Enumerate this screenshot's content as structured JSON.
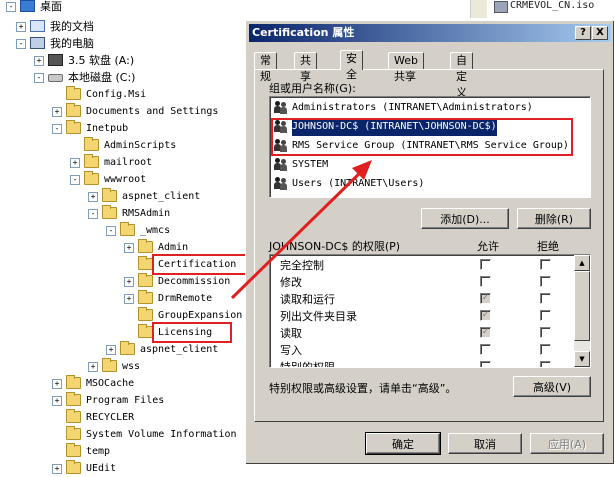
{
  "tree": [
    {
      "label": "桌面",
      "icon": "desktop-icon",
      "expander": "-"
    },
    {
      "label": "我的文档",
      "icon": "my-documents-icon",
      "expander": "+"
    },
    {
      "label": "我的电脑",
      "icon": "my-computer-icon",
      "expander": "-"
    },
    {
      "label": "3.5 软盘 (A:)",
      "icon": "floppy-drive-icon",
      "expander": "+"
    },
    {
      "label": "本地磁盘 (C:)",
      "icon": "local-disk-icon",
      "expander": "-"
    },
    {
      "label": "Config.Msi",
      "icon": "folder-icon",
      "expander": ""
    },
    {
      "label": "Documents and Settings",
      "icon": "folder-icon",
      "expander": "+"
    },
    {
      "label": "Inetpub",
      "icon": "folder-icon",
      "expander": "-"
    },
    {
      "label": "AdminScripts",
      "icon": "folder-icon",
      "expander": ""
    },
    {
      "label": "mailroot",
      "icon": "folder-icon",
      "expander": "+"
    },
    {
      "label": "wwwroot",
      "icon": "folder-icon",
      "expander": "-"
    },
    {
      "label": "aspnet_client",
      "icon": "folder-icon",
      "expander": "+"
    },
    {
      "label": "RMSAdmin",
      "icon": "folder-icon",
      "expander": "-"
    },
    {
      "label": "_wmcs",
      "icon": "folder-icon",
      "expander": "-"
    },
    {
      "label": "Admin",
      "icon": "folder-icon",
      "expander": "+"
    },
    {
      "label": "Certification",
      "icon": "folder-icon",
      "expander": ""
    },
    {
      "label": "Decommission",
      "icon": "folder-icon",
      "expander": "+"
    },
    {
      "label": "DrmRemote",
      "icon": "folder-icon",
      "expander": "+"
    },
    {
      "label": "GroupExpansion",
      "icon": "folder-icon",
      "expander": ""
    },
    {
      "label": "Licensing",
      "icon": "folder-icon",
      "expander": ""
    },
    {
      "label": "aspnet_client",
      "icon": "folder-icon",
      "expander": "+"
    },
    {
      "label": "wss",
      "icon": "folder-icon",
      "expander": "+"
    },
    {
      "label": "MSOCache",
      "icon": "folder-icon",
      "expander": "+"
    },
    {
      "label": "Program Files",
      "icon": "folder-icon",
      "expander": "+"
    },
    {
      "label": "RECYCLER",
      "icon": "folder-icon",
      "expander": ""
    },
    {
      "label": "System Volume Information",
      "icon": "folder-icon",
      "expander": ""
    },
    {
      "label": "temp",
      "icon": "folder-icon",
      "expander": ""
    },
    {
      "label": "UEdit",
      "icon": "folder-icon",
      "expander": "+"
    }
  ],
  "right_list_item": "CRMEVOL_CN.iso",
  "dialog": {
    "title": "Certification 属性",
    "help_btn": "?",
    "close_btn": "X",
    "tabs": [
      "常规",
      "共享",
      "安全",
      "Web 共享",
      "自定义"
    ],
    "group_label": "组或用户名称(G):",
    "users": [
      "Administrators (INTRANET\\Administrators)",
      "JOHNSON-DC$ (INTRANET\\JOHNSON-DC$)",
      "RMS Service Group (INTRANET\\RMS Service Group)",
      "SYSTEM",
      "Users (INTRANET\\Users)"
    ],
    "add_btn": "添加(D)...",
    "remove_btn": "删除(R)",
    "perm_label": "JOHNSON-DC$ 的权限(P)",
    "allow_col": "允许",
    "deny_col": "拒绝",
    "permissions": [
      {
        "name": "完全控制",
        "allow": false,
        "allow_grey": false
      },
      {
        "name": "修改",
        "allow": false,
        "allow_grey": false
      },
      {
        "name": "读取和运行",
        "allow": true,
        "allow_grey": true
      },
      {
        "name": "列出文件夹目录",
        "allow": true,
        "allow_grey": true
      },
      {
        "name": "读取",
        "allow": true,
        "allow_grey": true
      },
      {
        "name": "写入",
        "allow": false,
        "allow_grey": false
      },
      {
        "name": "特别的权限",
        "allow": false,
        "allow_grey": false
      }
    ],
    "advanced_hint": "特别权限或高级设置，请单击“高级”。",
    "advanced_btn": "高级(V)",
    "ok_btn": "确定",
    "cancel_btn": "取消",
    "apply_btn": "应用(A)"
  },
  "colors": {
    "annotation_red": "#e02020",
    "title_blue": "#0a246a",
    "selection_blue": "#0a246a"
  }
}
